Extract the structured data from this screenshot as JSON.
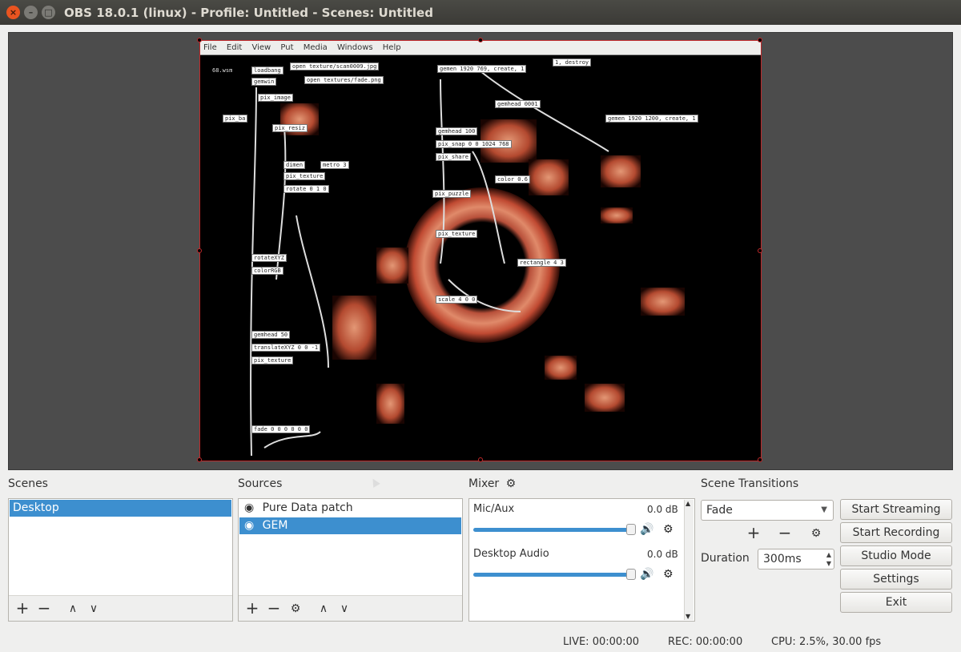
{
  "window": {
    "title": "OBS 18.0.1 (linux) - Profile: Untitled - Scenes: Untitled",
    "close_glyph": "×",
    "minimize_glyph": "–",
    "maximize_glyph": "□"
  },
  "preview": {
    "pd_menu": [
      "File",
      "Edit",
      "View",
      "Put",
      "Media",
      "Windows",
      "Help"
    ],
    "pd_boxes": [
      "68.wsm",
      "loadbang",
      "open texture/scan0009.jpg",
      "open textures/fade.png",
      "gemwin",
      "pix_image",
      "gemen 1920 769, create, 1",
      "1, destroy",
      "gemhead 0001",
      "gemen 1920 1200, create, 1",
      "pix_ba",
      "pix_resiz",
      "gemhead 100",
      "pix_snap 0 0 1024 768",
      "pix_share",
      "color 0.6",
      "dimen",
      "metro 3",
      "pix_texture",
      "rotate 0 1 0",
      "pix_puzzle",
      "rectangle 4 3",
      "rotateXYZ",
      "colorRGB",
      "pix_texture",
      "translateXYZ 0 0 -1",
      "gemhead 50",
      "pix_texture",
      "scale 4 0 0",
      "fade 0 0 0 0 0 0"
    ]
  },
  "scenes": {
    "title": "Scenes",
    "items": [
      "Desktop"
    ],
    "add": "+",
    "remove": "−",
    "up": "∧",
    "down": "∨"
  },
  "sources": {
    "title": "Sources",
    "items": [
      "Pure Data patch",
      "GEM"
    ],
    "eye_glyph": "◉",
    "add": "+",
    "remove": "−",
    "settings": "⚙",
    "up": "∧",
    "down": "∨"
  },
  "mixer": {
    "title": "Mixer",
    "gear": "⚙",
    "channels": [
      {
        "name": "Mic/Aux",
        "db": "0.0 dB",
        "level": 1.0
      },
      {
        "name": "Desktop Audio",
        "db": "0.0 dB",
        "level": 1.0
      }
    ],
    "speaker": "🔊",
    "gear_small": "⚙",
    "scroll_up": "▲",
    "scroll_down": "▼"
  },
  "transitions": {
    "title": "Scene Transitions",
    "selected": "Fade",
    "arrow": "▼",
    "add": "+",
    "remove": "−",
    "settings": "⚙",
    "duration_label": "Duration",
    "duration_value": "300ms",
    "spin_up": "▲",
    "spin_down": "▼"
  },
  "controls": {
    "start_streaming": "Start Streaming",
    "start_recording": "Start Recording",
    "studio_mode": "Studio Mode",
    "settings": "Settings",
    "exit": "Exit"
  },
  "status": {
    "live": "LIVE: 00:00:00",
    "rec": "REC: 00:00:00",
    "cpu": "CPU: 2.5%, 30.00 fps"
  }
}
